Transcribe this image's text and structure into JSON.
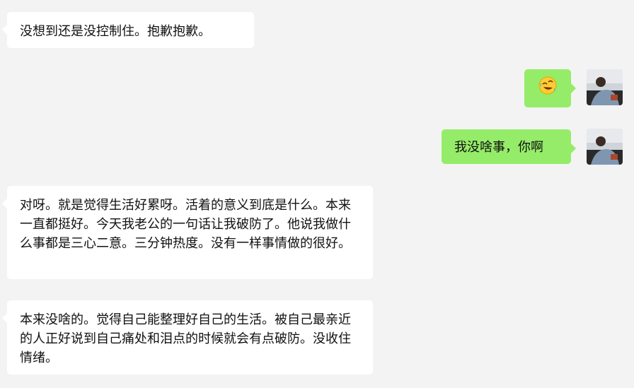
{
  "messages": [
    {
      "direction": "in",
      "text": "没想到还是没控制住。抱歉抱歉。"
    },
    {
      "direction": "out",
      "emoji": "rolling-on-floor-laughing-icon"
    },
    {
      "direction": "out",
      "text": "我没啥事，你啊"
    },
    {
      "direction": "in",
      "text": "对呀。就是觉得生活好累呀。活着的意义到底是什么。本来一直都挺好。今天我老公的一句话让我破防了。他说我做什么事都是三心二意。三分钟热度。没有一样事情做的很好。"
    },
    {
      "direction": "in",
      "text": "本来没啥的。觉得自己能整理好自己的生活。被自己最亲近的人正好说到自己痛处和泪点的时候就会有点破防。没收住情绪。"
    }
  ],
  "colors": {
    "background": "#f3f3f3",
    "incoming_bubble": "#ffffff",
    "outgoing_bubble": "#95ec69"
  },
  "icons": {
    "self_avatar": "user-avatar-photo"
  }
}
